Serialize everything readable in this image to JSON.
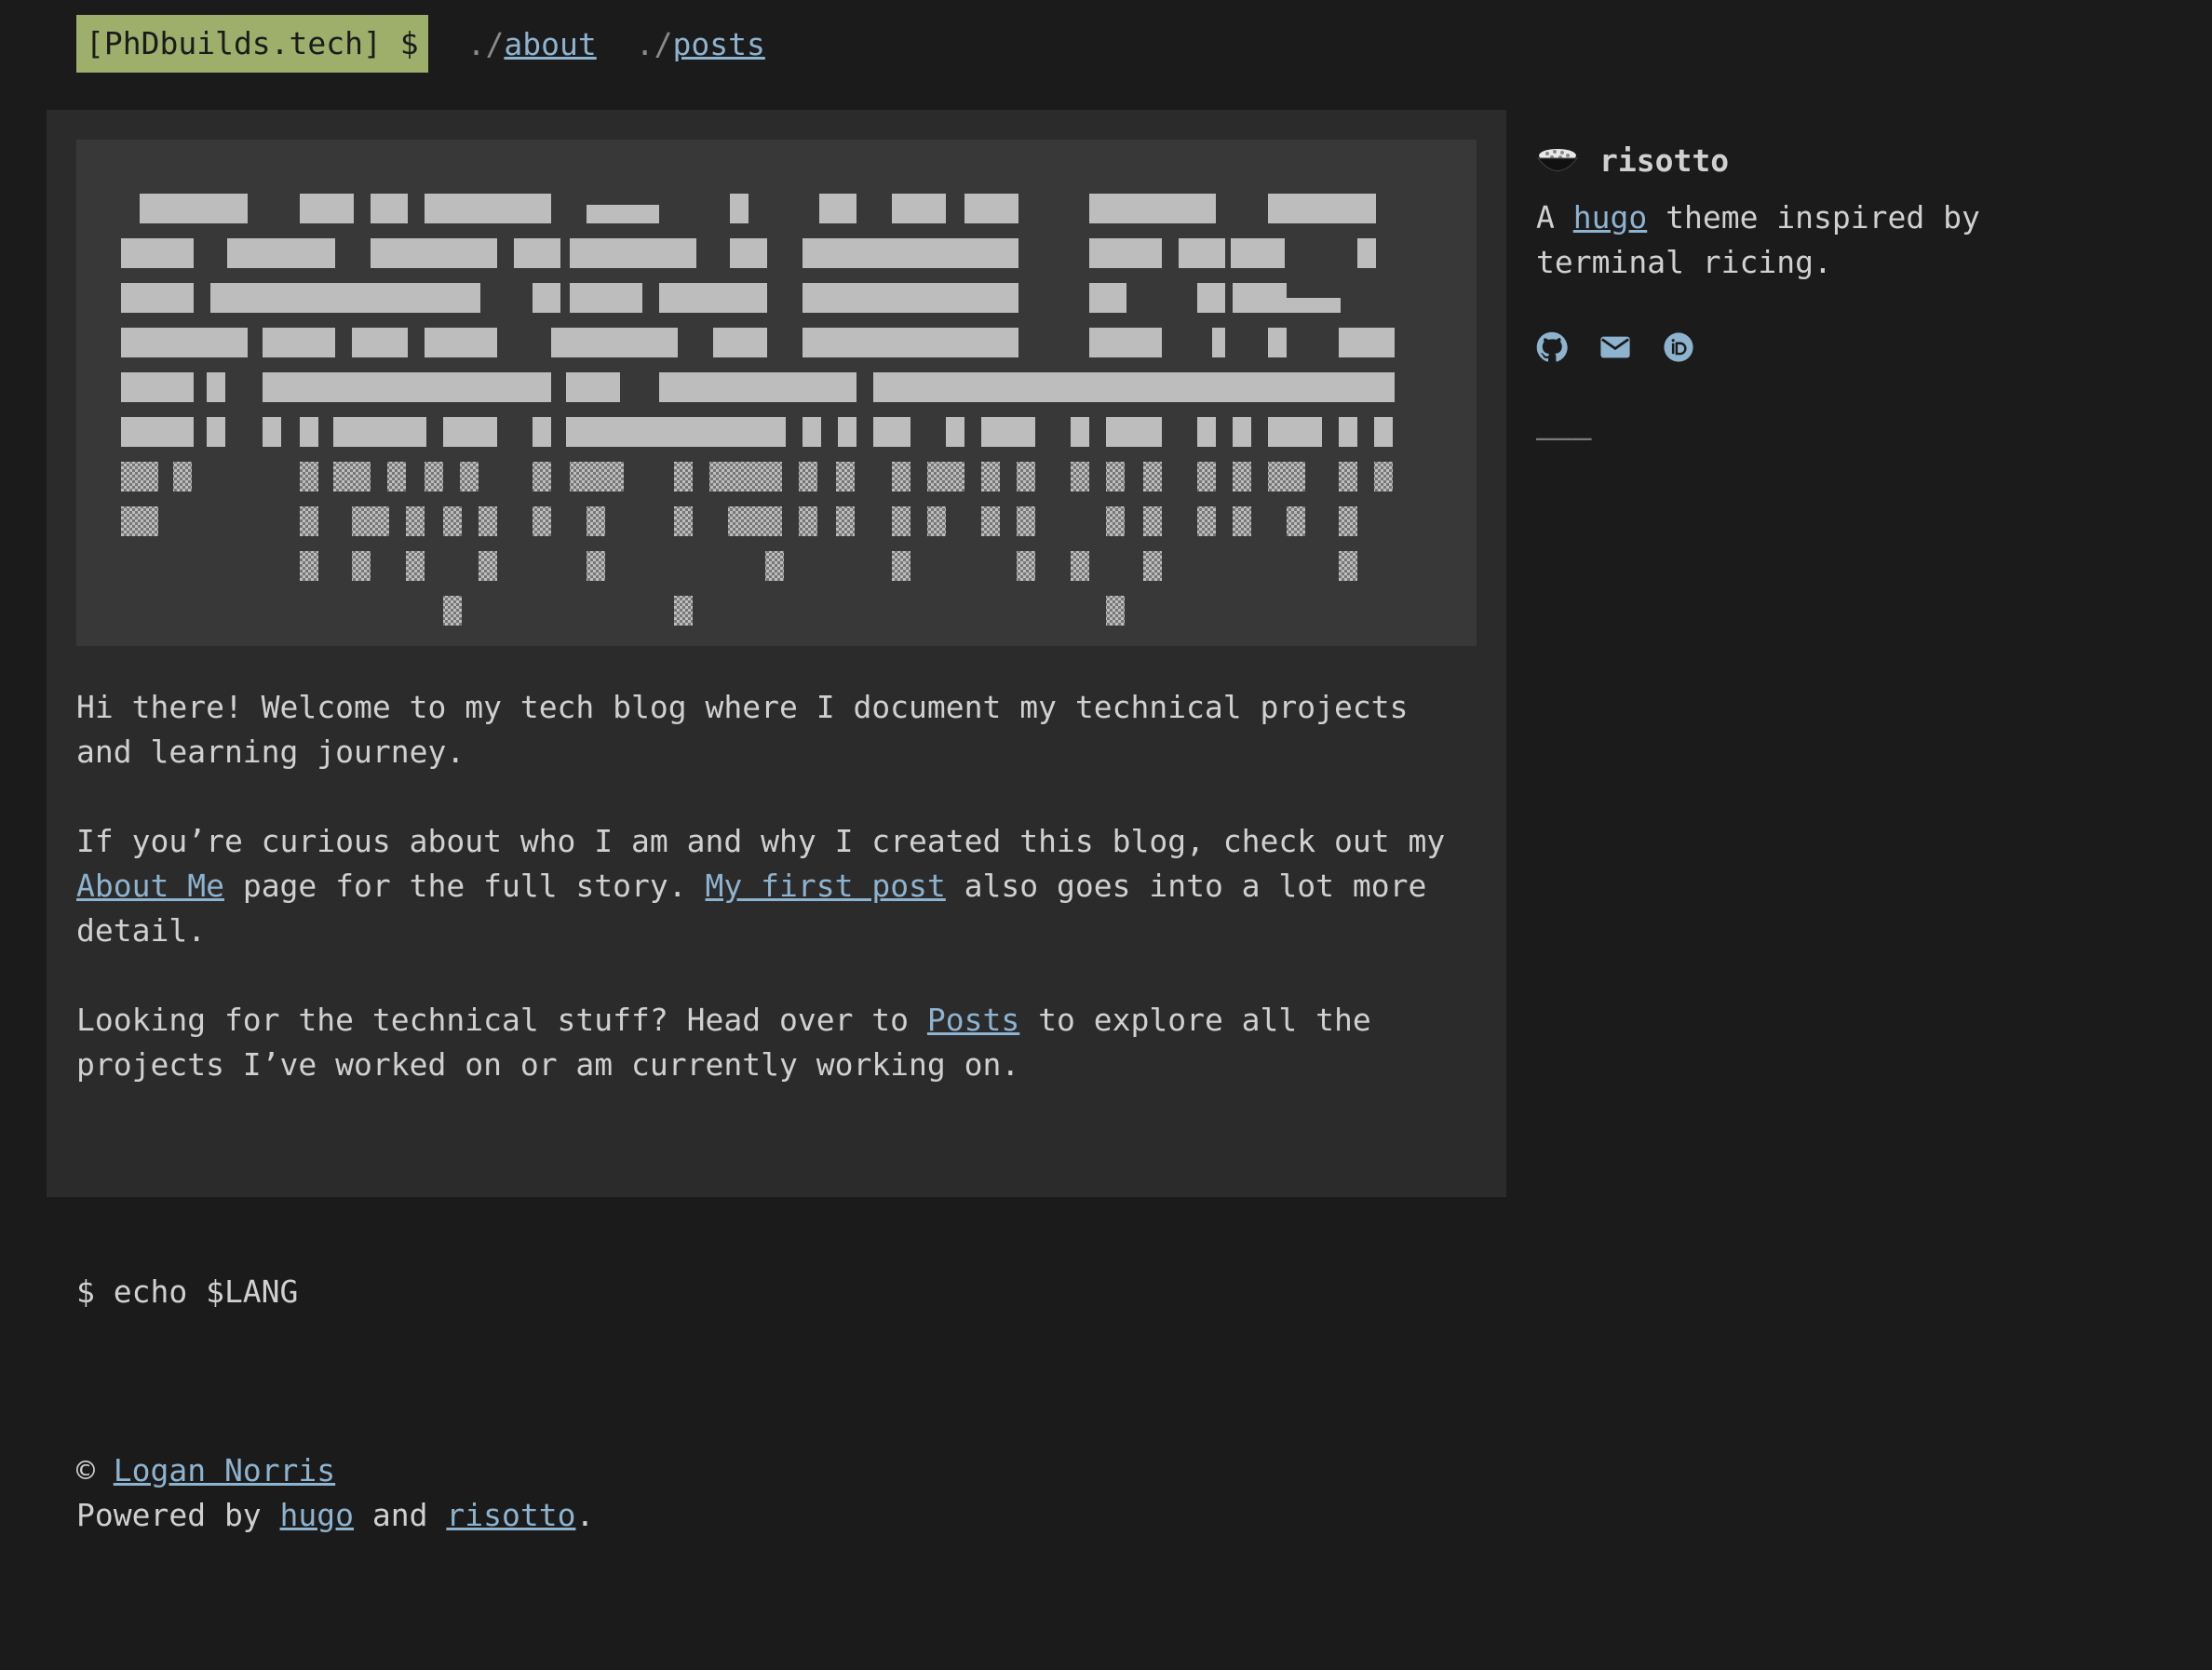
{
  "header": {
    "brand": "[PhDbuilds.tech] $",
    "nav": [
      {
        "prefix": "./",
        "label": "about"
      },
      {
        "prefix": "./",
        "label": "posts"
      }
    ]
  },
  "hero": {
    "icon": "ascii-art-banner"
  },
  "content": {
    "p1": "Hi there! Welcome to my tech blog where I document my technical projects and learning journey.",
    "p2_pre": "If you’re curious about who I am and why I created this blog, check out my ",
    "p2_link1": "About Me",
    "p2_mid": " page for the full story. ",
    "p2_link2": "My first post",
    "p2_post": " also goes into a lot more detail.",
    "p3_pre": "Looking for the technical stuff? Head over to ",
    "p3_link": "Posts",
    "p3_post": " to explore all the projects I’ve worked on or am currently working on."
  },
  "sidebar": {
    "title": "risotto",
    "title_icon": "risotto-bowl-icon",
    "desc_pre": "A ",
    "desc_link": "hugo",
    "desc_post": " theme inspired by terminal ricing.",
    "icons": [
      "github-icon",
      "mail-icon",
      "orcid-icon"
    ],
    "rule": "———"
  },
  "echo": "$ echo $LANG",
  "footer": {
    "copyright_symbol": "©",
    "author": "Logan Norris",
    "powered_pre": "Powered by ",
    "powered_link1": "hugo",
    "powered_mid": " and ",
    "powered_link2": "risotto",
    "powered_post": "."
  },
  "colors": {
    "background": "#1b1b1b",
    "panel": "#2b2b2b",
    "art_panel": "#383838",
    "brand_bg": "#9daf6b",
    "link": "#8eb3cf",
    "text": "#d0d0d0"
  }
}
